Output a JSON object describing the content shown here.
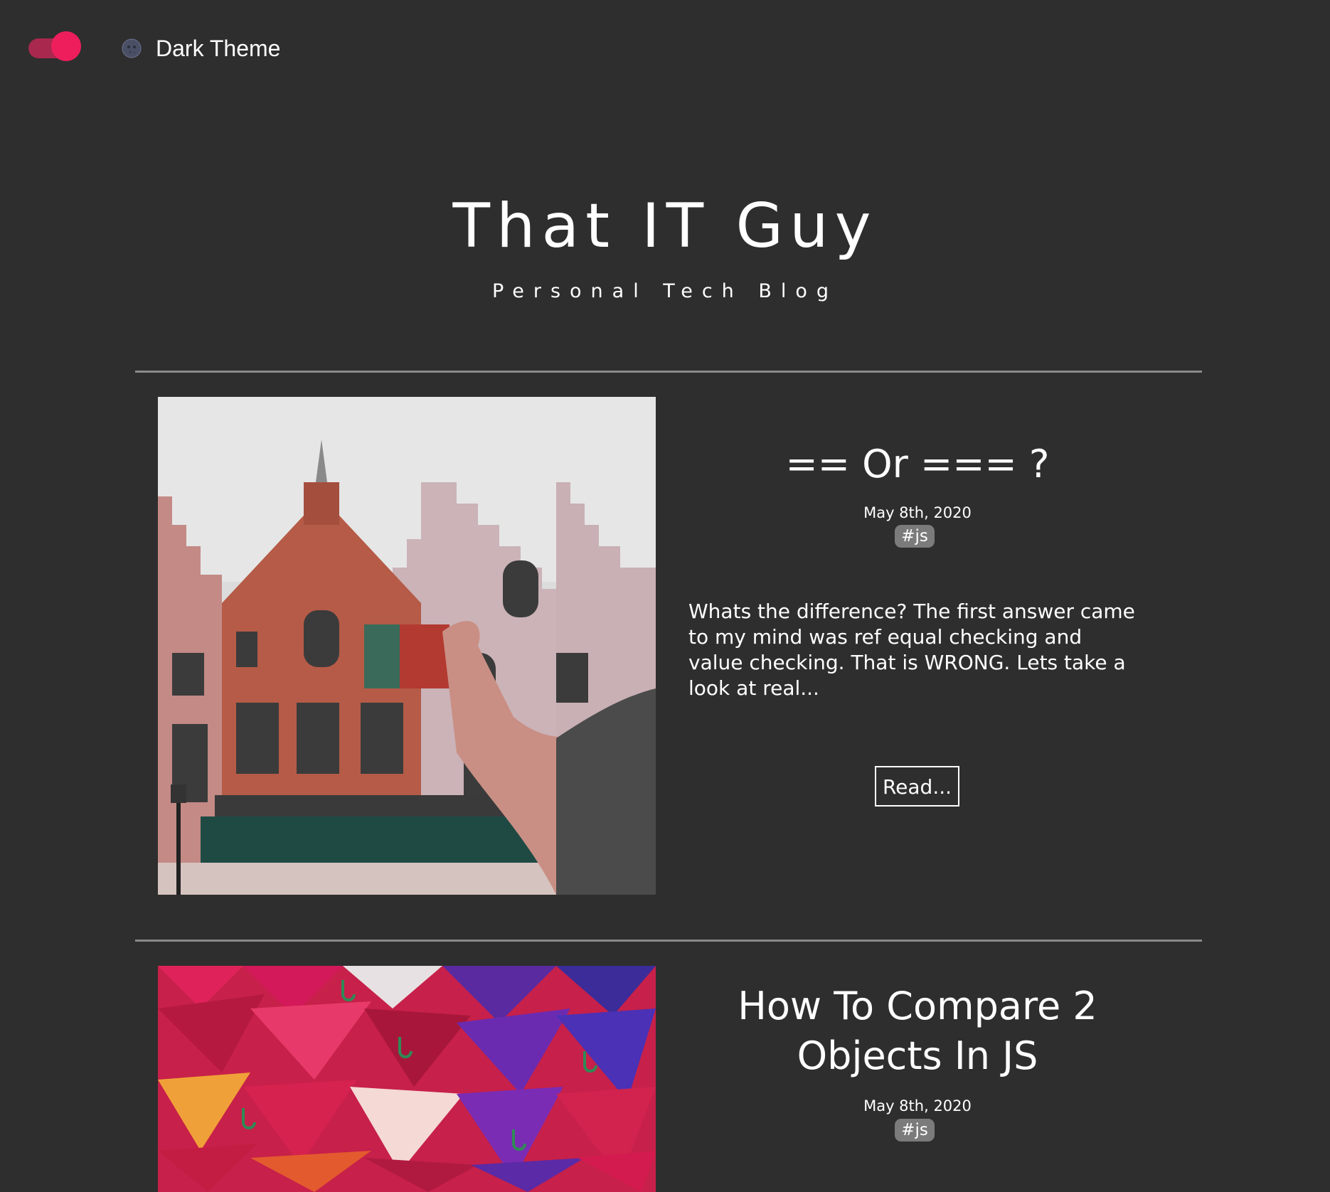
{
  "theme_toggle": {
    "label": "Dark Theme",
    "state": "on",
    "icon": "moon-icon",
    "track_color": "#a8284e",
    "knob_color": "#ee1e5c"
  },
  "header": {
    "title": "That IT Guy",
    "subtitle": "Personal Tech Blog"
  },
  "colors": {
    "background": "#2e2e2e",
    "text": "#ffffff",
    "divider": "#8a8a8a",
    "tag_background": "#7b7b7b"
  },
  "posts": [
    {
      "title": "== Or === ?",
      "date": "May 8th, 2020",
      "tag": "#js",
      "excerpt": "Whats the difference? The first answer came to my mind was ref equal checking and value checking. That is WRONG. Lets take a look at real...",
      "read_label": "Read...",
      "image": "building-photo"
    },
    {
      "title": "How To Compare 2 Objects In JS",
      "date": "May 8th, 2020",
      "tag": "#js",
      "image": "umbrellas-photo"
    }
  ]
}
